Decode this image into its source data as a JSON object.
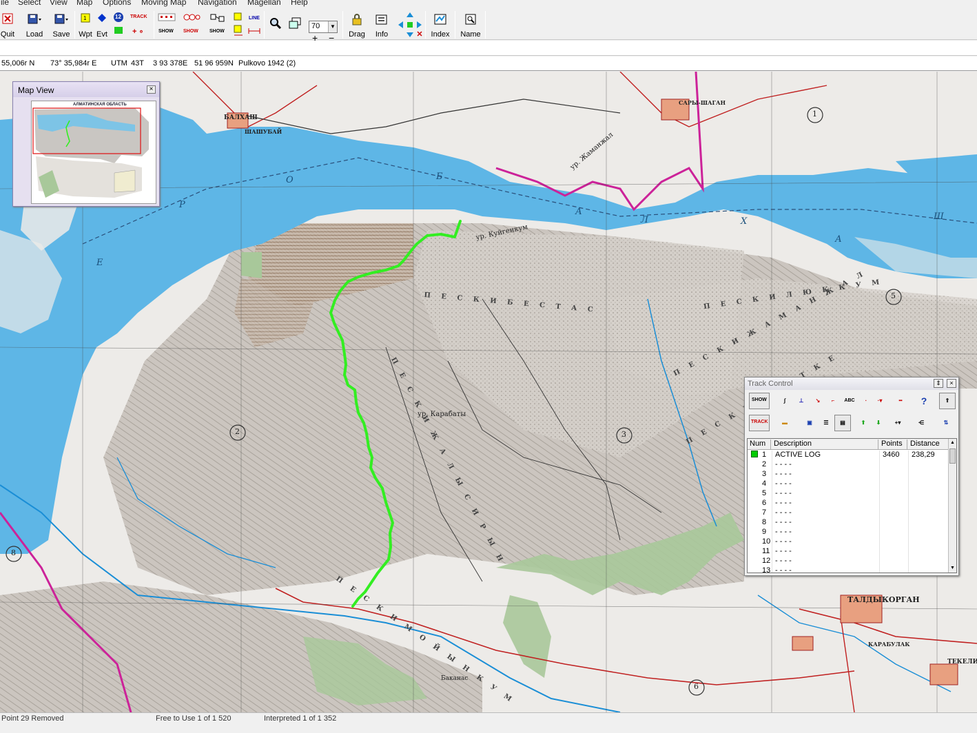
{
  "menu": [
    "ile",
    "Select",
    "View",
    "Map",
    "Options",
    "Moving Map",
    "Navigation",
    "Magellan",
    "Help"
  ],
  "toolbar": {
    "quit": "Quit",
    "load": "Load",
    "save": "Save",
    "wpt": "Wpt",
    "evt": "Evt",
    "evt_badge": "12",
    "track_tag": "TRACK",
    "show_tag": "SHOW",
    "line_tag": "LINE",
    "zoom_value": "70",
    "drag": "Drag",
    "info": "Info",
    "index": "Index",
    "name": "Name"
  },
  "coords": {
    "lat": "55,006r N",
    "lon": "73° 35,984r E",
    "utm_label": "UTM",
    "utm_zone": "43T",
    "easting": "3 93 378E",
    "northing": "51 96 959N",
    "datum": "Pulkovo 1942 (2)"
  },
  "status": {
    "left": "Point  29 Removed",
    "middle": "Free to Use  1 of 1 520",
    "right": "Interpreted  1 of 1 352"
  },
  "map_view": {
    "title": "Map View",
    "thumb_title": "АЛМАТИНСКАЯ ОБЛАСТЬ"
  },
  "map_labels": {
    "balkhash": "БАЛХАШ",
    "taldykorgan": "ТАЛДЫКОРГАН",
    "sands_bestas": "П Е С К И   Б Е С Т А С",
    "sands_lyukkum": "П Е С К И   Л Ю К К У М",
    "sands_zhamanzhal": "П Е С К И   Ж А М А Н Ж А Л",
    "sands_surtke": "П Е С К И   С У Р Т К Е",
    "sands_moyynkum": "П Е С К И   М О Й Ы Н К У М",
    "sands_sarykum": "П Е С К И   Ж А Л Ы С И Р Ы Н",
    "lake_letters_1": "О",
    "lake_letters_2": "Б",
    "lake_letters_3": "А",
    "lake_letters_4": "Л",
    "lake_letters_5": "Х",
    "lake_letters_6": "А",
    "lake_letters_7": "Ш",
    "lake_letters_8": "Р",
    "lake_letters_9": "Е",
    "karabaty": "ур. Карабаты",
    "kuyuk": "ур. Куйгенкум",
    "zhamanzhal": "ур. Жаманжал",
    "circle_1": "1",
    "circle_2": "2",
    "circle_3": "3",
    "circle_5": "5",
    "circle_6": "6",
    "circle_8": "8",
    "bakanas": "Баканас",
    "karabulak": "КАРАБУЛАК",
    "tekeli": "ТЕКЕЛИ",
    "saryshagan": "САРЫ-ШАГАН",
    "shashubai": "ШАШУБАЙ"
  },
  "track_control": {
    "title": "Track Control",
    "show_tag": "SHOW",
    "track_tag": "TRACK",
    "abc_tag": "ABC",
    "columns": [
      "Num",
      "Description",
      "Points",
      "Distance"
    ],
    "rows": [
      {
        "num": "1",
        "desc": "ACTIVE LOG",
        "points": "3460",
        "distance": "238,29",
        "active": true
      },
      {
        "num": "2",
        "desc": "- - - -",
        "points": "",
        "distance": ""
      },
      {
        "num": "3",
        "desc": "- - - -",
        "points": "",
        "distance": ""
      },
      {
        "num": "4",
        "desc": "- - - -",
        "points": "",
        "distance": ""
      },
      {
        "num": "5",
        "desc": "- - - -",
        "points": "",
        "distance": ""
      },
      {
        "num": "6",
        "desc": "- - - -",
        "points": "",
        "distance": ""
      },
      {
        "num": "7",
        "desc": "- - - -",
        "points": "",
        "distance": ""
      },
      {
        "num": "8",
        "desc": "- - - -",
        "points": "",
        "distance": ""
      },
      {
        "num": "9",
        "desc": "- - - -",
        "points": "",
        "distance": ""
      },
      {
        "num": "10",
        "desc": "- - - -",
        "points": "",
        "distance": ""
      },
      {
        "num": "11",
        "desc": "- - - -",
        "points": "",
        "distance": ""
      },
      {
        "num": "12",
        "desc": "- - - -",
        "points": "",
        "distance": ""
      },
      {
        "num": "13",
        "desc": "- - - -",
        "points": "",
        "distance": ""
      }
    ]
  },
  "colors": {
    "lake": "#5eb6e6",
    "track": "#33ee22",
    "desert": "#cfcac4",
    "border": "#cc2299",
    "green_area": "#a8c89a"
  }
}
